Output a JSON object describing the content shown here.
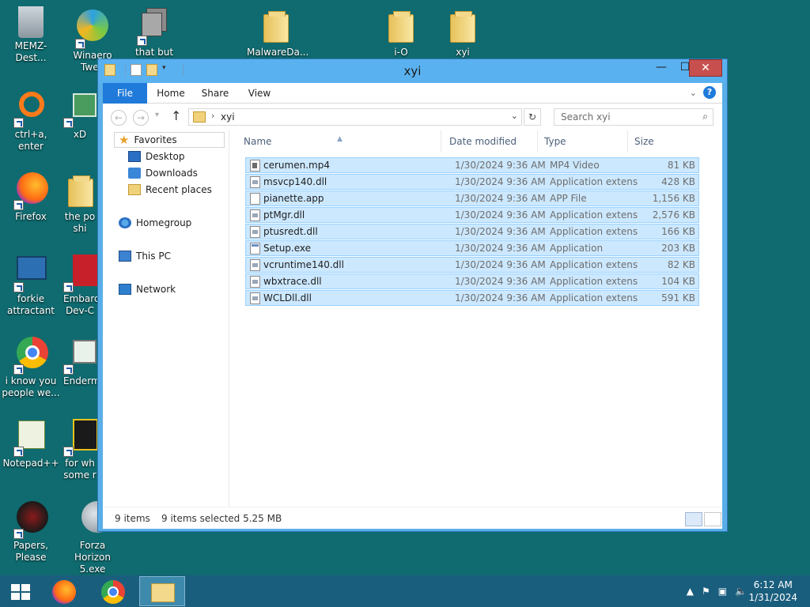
{
  "desktop": {
    "icons": [
      {
        "label": "MEMZ-Dest...",
        "icon": "recycle-bin-icon"
      },
      {
        "label": "Winaero Twea",
        "icon": "winaero-icon"
      },
      {
        "label": "that but when",
        "icon": "window-stack-icon"
      },
      {
        "label": "MalwareDa...",
        "icon": "folder-icon"
      },
      {
        "label": "i-O",
        "icon": "folder-icon"
      },
      {
        "label": "xyi",
        "icon": "folder-icon"
      },
      {
        "label": "ctrl+a, enter",
        "icon": "ring-icon"
      },
      {
        "label": "xD",
        "icon": "hex-icon"
      },
      {
        "label": "Firefox",
        "icon": "firefox-icon"
      },
      {
        "label": "the po shi",
        "icon": "folder-icon"
      },
      {
        "label": "forkie attractant",
        "icon": "monitor-gear-icon"
      },
      {
        "label": "Embarc Dev-C",
        "icon": "devcpp-icon"
      },
      {
        "label": "i know you people we...",
        "icon": "chrome-icon"
      },
      {
        "label": "Enderm",
        "icon": "picture-icon"
      },
      {
        "label": "Notepad++",
        "icon": "notepad-icon"
      },
      {
        "label": "for wh some r",
        "icon": "app-icon"
      },
      {
        "label": "Papers, Please",
        "icon": "papers-icon"
      },
      {
        "label": "Forza Horizon 5.exe",
        "icon": "flash-icon"
      }
    ]
  },
  "window": {
    "title": "xyi",
    "ribbon_tabs": [
      "File",
      "Home",
      "Share",
      "View"
    ],
    "address": "xyi",
    "search_placeholder": "Search xyi",
    "nav": {
      "favorites": "Favorites",
      "desktop": "Desktop",
      "downloads": "Downloads",
      "recent": "Recent places",
      "homegroup": "Homegroup",
      "thispc": "This PC",
      "network": "Network"
    },
    "columns": {
      "name": "Name",
      "date": "Date modified",
      "type": "Type",
      "size": "Size"
    },
    "files": [
      {
        "name": "cerumen.mp4",
        "date": "1/30/2024 9:36 AM",
        "type": "MP4 Video",
        "size": "81 KB"
      },
      {
        "name": "msvcp140.dll",
        "date": "1/30/2024 9:36 AM",
        "type": "Application extens...",
        "size": "428 KB"
      },
      {
        "name": "pianette.app",
        "date": "1/30/2024 9:36 AM",
        "type": "APP File",
        "size": "1,156 KB"
      },
      {
        "name": "ptMgr.dll",
        "date": "1/30/2024 9:36 AM",
        "type": "Application extens...",
        "size": "2,576 KB"
      },
      {
        "name": "ptusredt.dll",
        "date": "1/30/2024 9:36 AM",
        "type": "Application extens...",
        "size": "166 KB"
      },
      {
        "name": "Setup.exe",
        "date": "1/30/2024 9:36 AM",
        "type": "Application",
        "size": "203 KB"
      },
      {
        "name": "vcruntime140.dll",
        "date": "1/30/2024 9:36 AM",
        "type": "Application extens...",
        "size": "82 KB"
      },
      {
        "name": "wbxtrace.dll",
        "date": "1/30/2024 9:36 AM",
        "type": "Application extens...",
        "size": "104 KB"
      },
      {
        "name": "WCLDll.dll",
        "date": "1/30/2024 9:36 AM",
        "type": "Application extens...",
        "size": "591 KB"
      }
    ],
    "status": {
      "count": "9 items",
      "selected": "9 items selected  5.25 MB"
    }
  },
  "taskbar": {
    "time": "6:12 AM",
    "date": "1/31/2024"
  }
}
